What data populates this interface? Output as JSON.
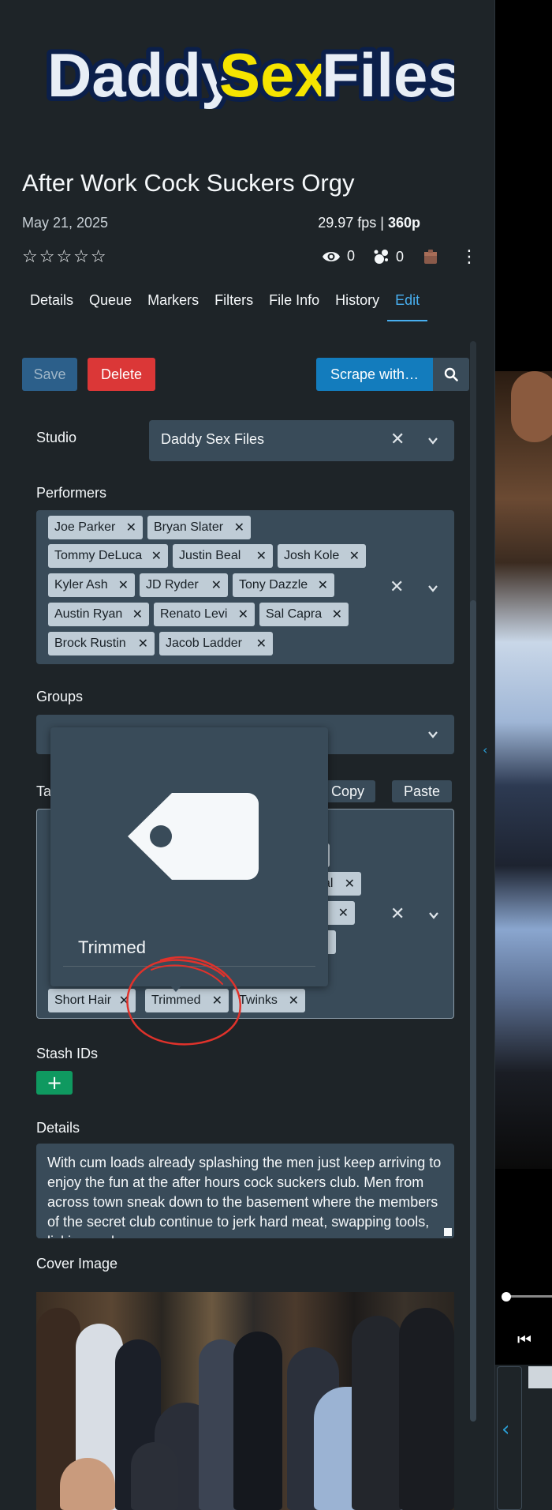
{
  "logo": {
    "part1": "Daddy",
    "part2": "Sex",
    "part3": "Files"
  },
  "scene": {
    "title": "After Work Cock Suckers Orgy",
    "date": "May 21, 2025",
    "fps": "29.97 fps |",
    "resolution": "360p",
    "rating_stars": "☆☆☆☆☆",
    "views": "0",
    "o_count": "0"
  },
  "tabs": [
    {
      "label": "Details"
    },
    {
      "label": "Queue"
    },
    {
      "label": "Markers"
    },
    {
      "label": "Filters"
    },
    {
      "label": "File Info"
    },
    {
      "label": "History"
    },
    {
      "label": "Edit"
    }
  ],
  "toolbar": {
    "save_label": "Save",
    "delete_label": "Delete",
    "scrape_label": "Scrape with…"
  },
  "form": {
    "studio_label": "Studio",
    "studio_value": "Daddy Sex Files",
    "performers_label": "Performers",
    "performers": [
      "Joe Parker",
      "Bryan Slater",
      "Tommy DeLuca",
      "Justin Beal",
      "Josh Kole",
      "Kyler Ash",
      "JD Ryder",
      "Tony Dazzle",
      "Austin Ryan",
      "Renato Levi",
      "Sal Capra",
      "Brock Rustin",
      "Jacob Ladder"
    ],
    "groups_label": "Groups",
    "tags_label": "Ta",
    "copy_label": "Copy",
    "paste_label": "Paste",
    "tags_visible": [
      "Short Hair",
      "Trimmed",
      "Twinks"
    ],
    "tags_partial": [
      "al"
    ],
    "stash_ids_label": "Stash IDs",
    "stash_add": "+",
    "details_label": "Details",
    "details_text": "With cum loads already splashing the men just keep arriving to enjoy the fun at the after hours cock suckers club. Men from across town sneak down to the basement where the members of the secret club continue to jerk hard meat, swapping tools, licking and",
    "cover_label": "Cover Image"
  },
  "tag_popover": {
    "name": "Trimmed"
  },
  "icons": {
    "eye": "eye-icon",
    "o_counter": "splash-icon",
    "organized": "box-icon",
    "menu": "kebab-icon",
    "search": "search-icon",
    "tag": "tag-icon"
  },
  "colors": {
    "accent": "#48aff0",
    "primary": "#137cbd",
    "danger": "#db3737",
    "success": "#0f9960",
    "annotation": "#e0322b"
  }
}
